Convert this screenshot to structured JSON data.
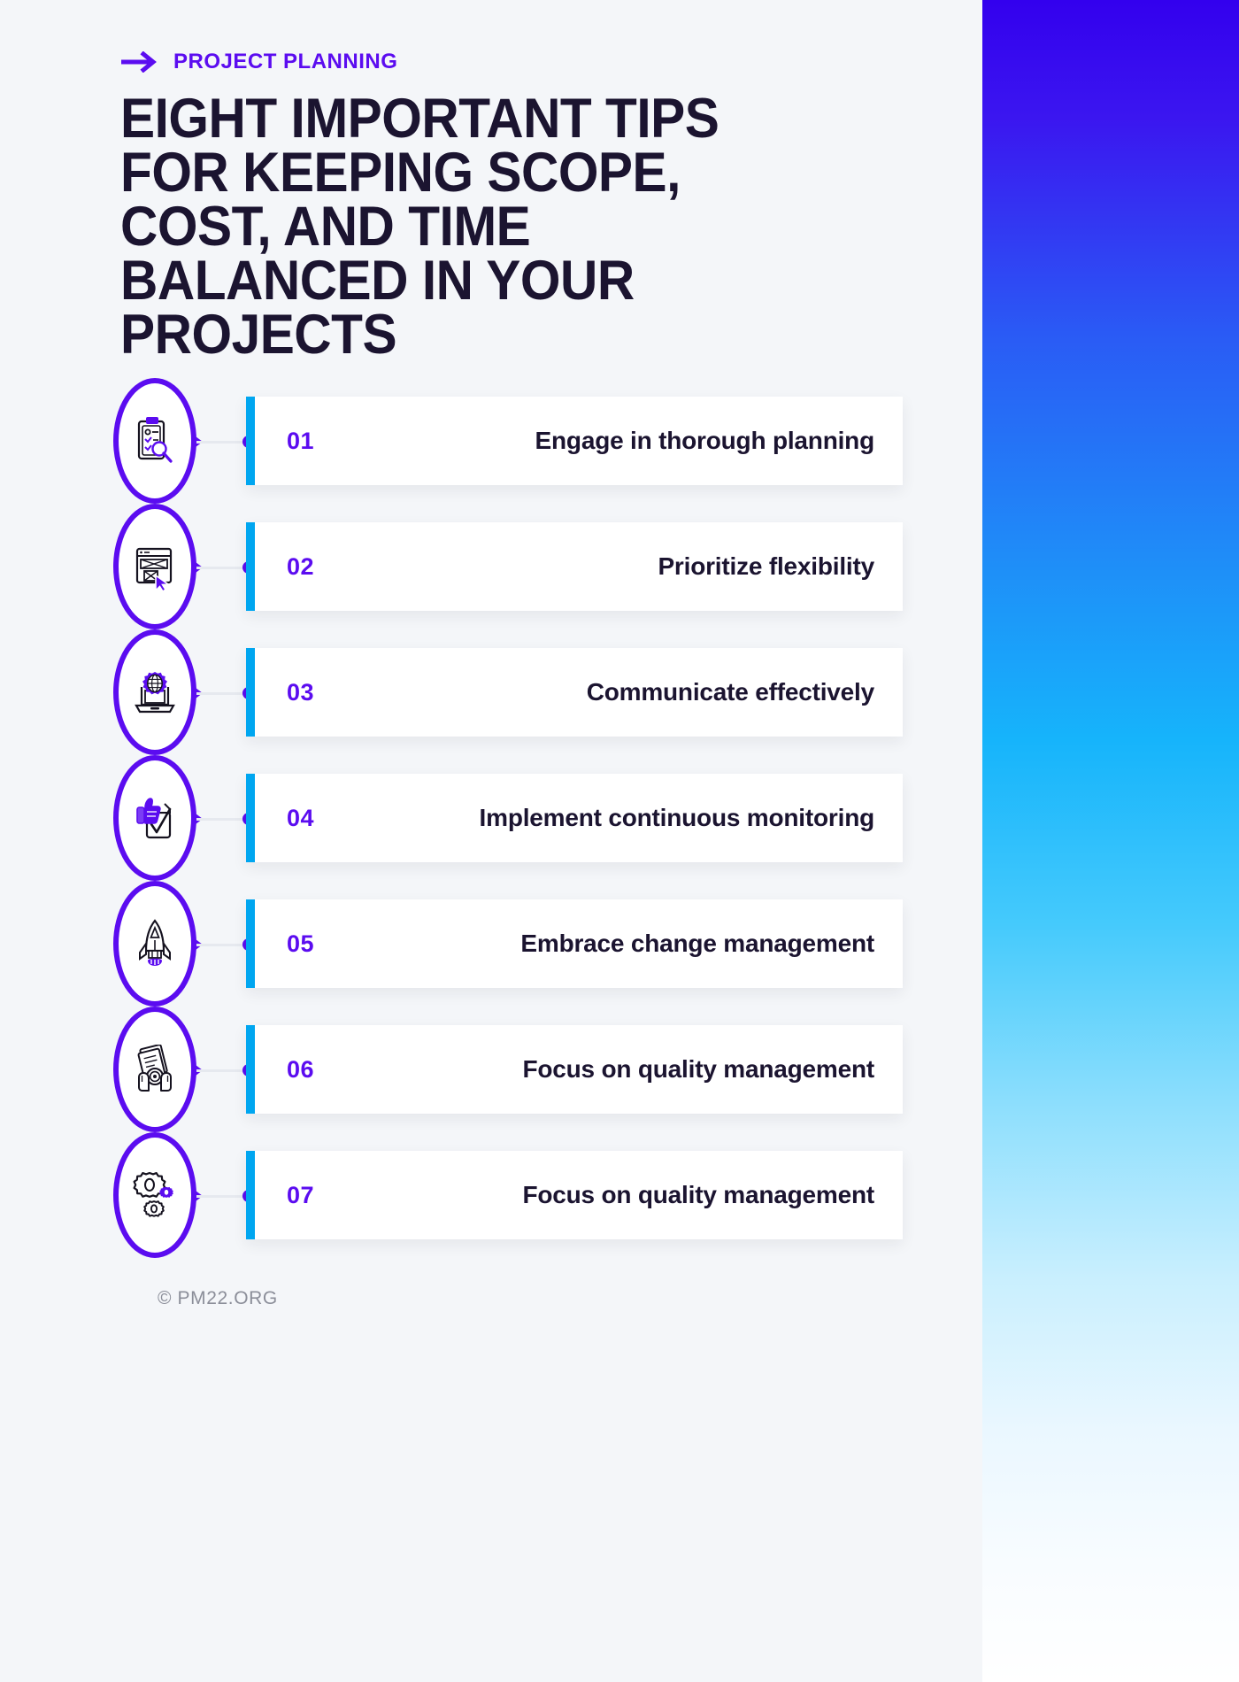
{
  "theme": {
    "background": "#f4f6f9",
    "accent_purple": "#5b0cf0",
    "accent_cyan": "#00a6f0",
    "text_dark": "#1b1430",
    "card_background": "#ffffff",
    "footer_text": "#8b8e99"
  },
  "header": {
    "eyebrow": "PROJECT PLANNING",
    "eyebrow_icon": "arrow-right-icon",
    "title_lines": [
      "EIGHT IMPORTANT TIPS",
      "FOR KEEPING SCOPE,",
      "COST, AND TIME",
      "BALANCED IN YOUR",
      "PROJECTS"
    ]
  },
  "tips": [
    {
      "number": "01",
      "text": "Engage in thorough planning",
      "icon": "clipboard-search-icon"
    },
    {
      "number": "02",
      "text": "Prioritize flexibility",
      "icon": "browser-cursor-icon"
    },
    {
      "number": "03",
      "text": "Communicate effectively",
      "icon": "laptop-globe-gear-icon"
    },
    {
      "number": "04",
      "text": "Implement continuous monitoring",
      "icon": "thumbs-up-checklist-icon"
    },
    {
      "number": "05",
      "text": "Embrace change management",
      "icon": "rocket-icon"
    },
    {
      "number": "06",
      "text": "Focus on quality management",
      "icon": "hands-documents-target-icon"
    },
    {
      "number": "07",
      "text": "Focus on quality management",
      "icon": "gears-icon"
    }
  ],
  "footer": {
    "copyright": "© PM22.ORG"
  }
}
